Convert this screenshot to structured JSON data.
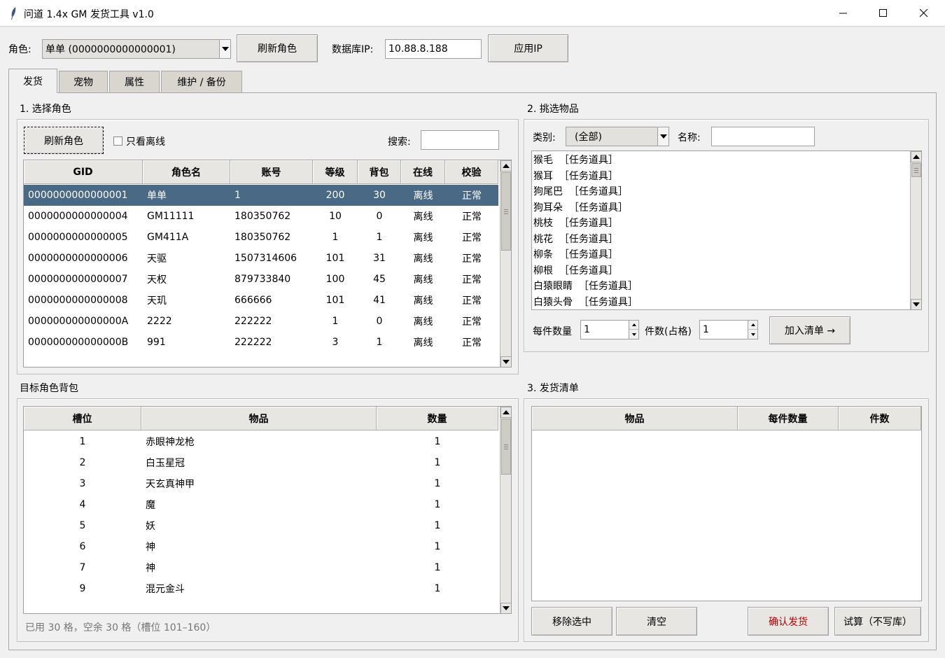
{
  "window": {
    "title": "问道 1.4x GM 发货工具  v1.0"
  },
  "top": {
    "role_label": "角色:",
    "role_value": "单单 (0000000000000001)",
    "refresh_button": "刷新角色",
    "db_ip_label": "数据库IP:",
    "db_ip_value": "10.88.8.188",
    "apply_ip_button": "应用IP"
  },
  "tabs": [
    {
      "label": "发货",
      "active": true
    },
    {
      "label": "宠物",
      "active": false
    },
    {
      "label": "属性",
      "active": false
    },
    {
      "label": "维护 / 备份",
      "active": false
    }
  ],
  "select_role": {
    "group_label": "1. 选择角色",
    "refresh_button": "刷新角色",
    "offline_only_label": "只看离线",
    "search_label": "搜索:",
    "search_value": "",
    "columns": [
      "GID",
      "角色名",
      "账号",
      "等级",
      "背包",
      "在线",
      "校验"
    ],
    "rows": [
      [
        "0000000000000001",
        "单单",
        "1",
        "200",
        "30",
        "离线",
        "正常"
      ],
      [
        "0000000000000004",
        "GM11111",
        "180350762",
        "10",
        "0",
        "离线",
        "正常"
      ],
      [
        "0000000000000005",
        "GM411A",
        "180350762",
        "1",
        "1",
        "离线",
        "正常"
      ],
      [
        "0000000000000006",
        "天驱",
        "1507314606",
        "101",
        "31",
        "离线",
        "正常"
      ],
      [
        "0000000000000007",
        "天权",
        "879733840",
        "100",
        "45",
        "离线",
        "正常"
      ],
      [
        "0000000000000008",
        "天玑",
        "666666",
        "101",
        "41",
        "离线",
        "正常"
      ],
      [
        "000000000000000A",
        "2222",
        "222222",
        "1",
        "0",
        "离线",
        "正常"
      ],
      [
        "000000000000000B",
        "991",
        "222222",
        "3",
        "1",
        "离线",
        "正常"
      ]
    ]
  },
  "pick_items": {
    "group_label": "2. 挑选物品",
    "category_label": "类别:",
    "category_value": "(全部)",
    "name_label": "名称:",
    "name_value": "",
    "items": [
      "猴毛  ［任务道具］",
      "猴耳  ［任务道具］",
      "狗尾巴  ［任务道具］",
      "狗耳朵  ［任务道具］",
      "桃枝  ［任务道具］",
      "桃花  ［任务道具］",
      "柳条  ［任务道具］",
      "柳根  ［任务道具］",
      "白猿眼睛  ［任务道具］",
      "白猿头骨  ［任务道具］"
    ],
    "per_qty_label": "每件数量",
    "per_qty_value": "1",
    "count_label": "件数(占格)",
    "count_value": "1",
    "add_button": "加入清单 →"
  },
  "bag": {
    "group_label": "目标角色背包",
    "columns": [
      "槽位",
      "物品",
      "数量"
    ],
    "rows": [
      [
        "1",
        "赤眼神龙枪",
        "1"
      ],
      [
        "2",
        "白玉星冠",
        "1"
      ],
      [
        "3",
        "天玄真神甲",
        "1"
      ],
      [
        "4",
        "魔",
        "1"
      ],
      [
        "5",
        "妖",
        "1"
      ],
      [
        "6",
        "神",
        "1"
      ],
      [
        "7",
        "神",
        "1"
      ],
      [
        "9",
        "混元金斗",
        "1"
      ]
    ],
    "status": "已用 30 格，空余 30 格（槽位 101–160）"
  },
  "ship_list": {
    "group_label": "3. 发货清单",
    "columns": [
      "物品",
      "每件数量",
      "件数"
    ],
    "remove_button": "移除选中",
    "clear_button": "清空",
    "confirm_button": "确认发货",
    "trial_button": "试算（不写库）",
    "confirm_color": "#c00000"
  },
  "colors": {
    "selection": "#4a6984",
    "background": "#f0f0f0"
  }
}
